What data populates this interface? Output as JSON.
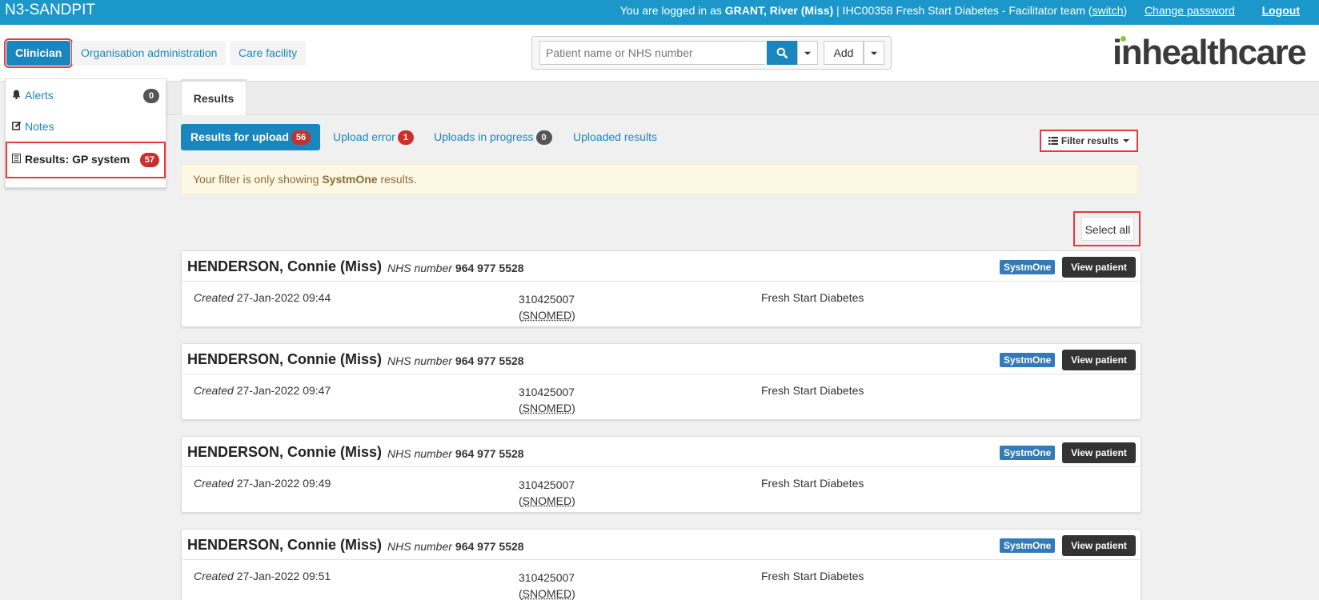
{
  "topbar": {
    "env": "N3-SANDPIT",
    "logged_prefix": "You are logged in as",
    "user": "GRANT, River (Miss)",
    "team": "| IHC00358 Fresh Start Diabetes - Facilitator team",
    "switch_label": "switch",
    "change_password": "Change password",
    "logout": "Logout"
  },
  "nav": {
    "tabs": [
      "Clinician",
      "Organisation administration",
      "Care facility"
    ],
    "active_index": 0
  },
  "search": {
    "placeholder": "Patient name or NHS number",
    "add_label": "Add",
    "search_icon": "search-icon"
  },
  "logo": {
    "text": "inhealthcare",
    "dot_color": "#8cc63e"
  },
  "sidebar": {
    "items": [
      {
        "label": "Alerts",
        "count": "0",
        "icon": "bell-icon"
      },
      {
        "label": "Notes",
        "count": "",
        "icon": "edit-icon"
      },
      {
        "label": "Results: GP system",
        "count": "57",
        "icon": "list-icon"
      }
    ]
  },
  "main": {
    "tab_label": "Results",
    "subtabs": [
      {
        "label": "Results for upload",
        "count": "56"
      },
      {
        "label": "Upload error",
        "count": "1"
      },
      {
        "label": "Uploads in progress",
        "count": "0"
      },
      {
        "label": "Uploaded results",
        "count": ""
      }
    ],
    "filter_label": "Filter results",
    "notice_pre": "Your filter is only showing",
    "notice_sys": "SystmOne",
    "notice_post": "results.",
    "select_all": "Select all"
  },
  "colors": {
    "primary": "#1a86be",
    "topbar": "#1b98c9",
    "danger": "#c9302c",
    "highlight": "#e03c3c"
  },
  "results": [
    {
      "name": "HENDERSON, Connie (Miss)",
      "nhs_label": "NHS number",
      "nhs": "964 977 5528",
      "source": "SystmOne",
      "view_label": "View patient",
      "created_label": "Created",
      "created": "27-Jan-2022 09:44",
      "code": "310425007",
      "code_open": "(",
      "code_system": "SNOMED",
      "code_close": ")",
      "service": "Fresh Start Diabetes"
    },
    {
      "name": "HENDERSON, Connie (Miss)",
      "nhs_label": "NHS number",
      "nhs": "964 977 5528",
      "source": "SystmOne",
      "view_label": "View patient",
      "created_label": "Created",
      "created": "27-Jan-2022 09:47",
      "code": "310425007",
      "code_open": "(",
      "code_system": "SNOMED",
      "code_close": ")",
      "service": "Fresh Start Diabetes"
    },
    {
      "name": "HENDERSON, Connie (Miss)",
      "nhs_label": "NHS number",
      "nhs": "964 977 5528",
      "source": "SystmOne",
      "view_label": "View patient",
      "created_label": "Created",
      "created": "27-Jan-2022 09:49",
      "code": "310425007",
      "code_open": "(",
      "code_system": "SNOMED",
      "code_close": ")",
      "service": "Fresh Start Diabetes"
    },
    {
      "name": "HENDERSON, Connie (Miss)",
      "nhs_label": "NHS number",
      "nhs": "964 977 5528",
      "source": "SystmOne",
      "view_label": "View patient",
      "created_label": "Created",
      "created": "27-Jan-2022 09:51",
      "code": "310425007",
      "code_open": "(",
      "code_system": "SNOMED",
      "code_close": ")",
      "service": "Fresh Start Diabetes"
    }
  ]
}
